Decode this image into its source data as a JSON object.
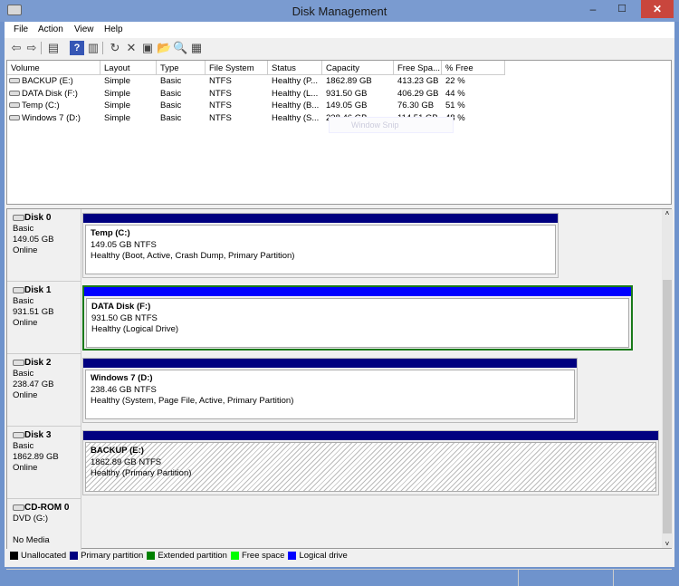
{
  "window": {
    "title": "Disk Management",
    "minimize": "–",
    "maximize": "☐",
    "close": "✕"
  },
  "menu": [
    "File",
    "Action",
    "View",
    "Help"
  ],
  "toolbar": {
    "icons": [
      "back-icon",
      "forward-icon",
      "show-hide-console-tree-icon",
      "help-icon",
      "show-hide-action-pane-icon",
      "refresh-icon",
      "delete-icon",
      "properties-icon",
      "open-icon",
      "explore-icon",
      "rescan-disks-icon"
    ],
    "glyphs": [
      "⇦",
      "⇨",
      "▤",
      "?",
      "▥",
      "↻",
      "✕",
      "▣",
      "📂",
      "🔍",
      "▦"
    ]
  },
  "volume_list": {
    "columns": [
      "Volume",
      "Layout",
      "Type",
      "File System",
      "Status",
      "Capacity",
      "Free Spa...",
      "% Free"
    ],
    "rows": [
      [
        "BACKUP (E:)",
        "Simple",
        "Basic",
        "NTFS",
        "Healthy (P...",
        "1862.89 GB",
        "413.23 GB",
        "22 %"
      ],
      [
        "DATA Disk (F:)",
        "Simple",
        "Basic",
        "NTFS",
        "Healthy (L...",
        "931.50 GB",
        "406.29 GB",
        "44 %"
      ],
      [
        "Temp (C:)",
        "Simple",
        "Basic",
        "NTFS",
        "Healthy (B...",
        "149.05 GB",
        "76.30 GB",
        "51 %"
      ],
      [
        "Windows 7 (D:)",
        "Simple",
        "Basic",
        "NTFS",
        "Healthy (S...",
        "238.46 GB",
        "114.51 GB",
        "48 %"
      ]
    ]
  },
  "overlay": {
    "window_snip": "Window Snip"
  },
  "disks": [
    {
      "name": "Disk 0",
      "type": "Basic",
      "size": "149.05 GB",
      "state": "Online",
      "partition": {
        "title": "Temp  (C:)",
        "size": "149.05 GB NTFS",
        "status": "Healthy (Boot, Active, Crash Dump, Primary Partition)",
        "kind": "primary"
      }
    },
    {
      "name": "Disk 1",
      "type": "Basic",
      "size": "931.51 GB",
      "state": "Online",
      "partition": {
        "title": "DATA Disk  (F:)",
        "size": "931.50 GB NTFS",
        "status": "Healthy (Logical Drive)",
        "kind": "logical",
        "selected": true
      }
    },
    {
      "name": "Disk 2",
      "type": "Basic",
      "size": "238.47 GB",
      "state": "Online",
      "partition": {
        "title": "Windows 7  (D:)",
        "size": "238.46 GB NTFS",
        "status": "Healthy (System, Page File, Active, Primary Partition)",
        "kind": "primary"
      }
    },
    {
      "name": "Disk 3",
      "type": "Basic",
      "size": "1862.89 GB",
      "state": "Online",
      "partition": {
        "title": "BACKUP  (E:)",
        "size": "1862.89 GB NTFS",
        "status": "Healthy (Primary Partition)",
        "kind": "primary",
        "hatched": true
      }
    }
  ],
  "cdrom": {
    "name": "CD-ROM 0",
    "drive": "DVD (G:)",
    "state": "No Media"
  },
  "legend": [
    {
      "label": "Unallocated",
      "color": "#000000"
    },
    {
      "label": "Primary partition",
      "color": "#000080"
    },
    {
      "label": "Extended partition",
      "color": "#008000"
    },
    {
      "label": "Free space",
      "color": "#00ff00"
    },
    {
      "label": "Logical drive",
      "color": "#0000ff"
    }
  ]
}
